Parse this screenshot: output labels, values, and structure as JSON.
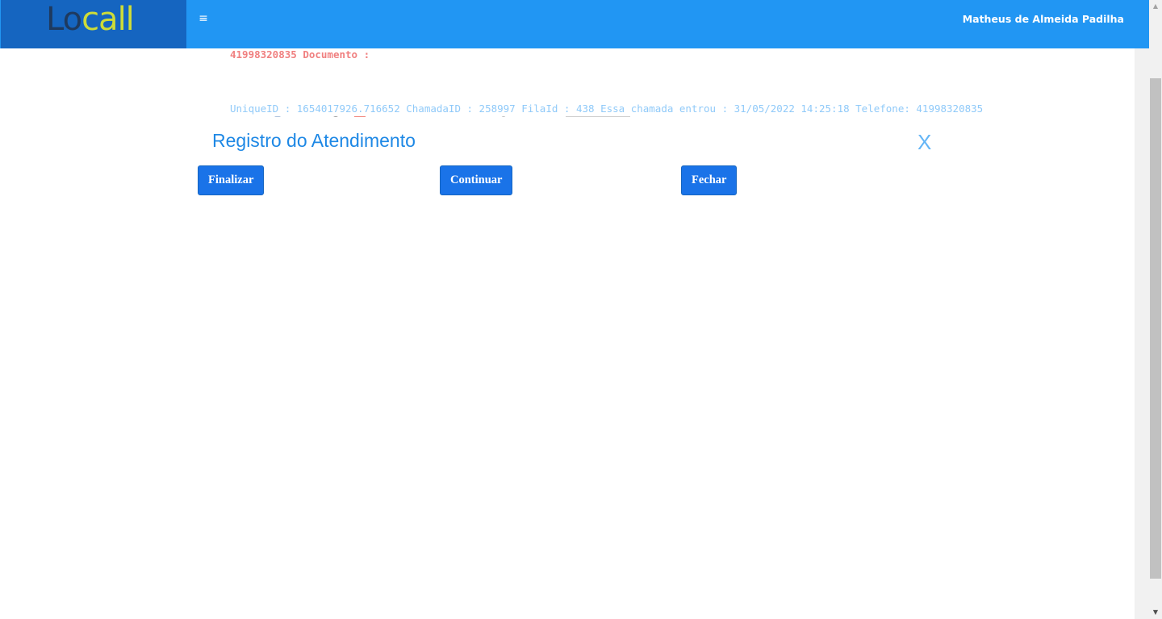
{
  "header": {
    "logo_text_lo": "Lo",
    "logo_text_call": "call",
    "user_name": "Matheus de Almeida Padilha",
    "menu_icon": "hamburger-icon"
  },
  "background": {
    "doc_number": "41998320835",
    "doc_label": "Documento :",
    "call_info": "UniqueID : 1654017926.716652 ChamadaID : 258997 FilaId : 438 Essa chamada entrou : 31/05/2022 14:25:18 Telefone: 41998320835"
  },
  "modal": {
    "title": "Registro do Atendimento",
    "close_label": "X",
    "buttons": {
      "finalizar": "Finalizar",
      "continuar": "Continuar",
      "fechar": "Fechar"
    }
  },
  "colors": {
    "topbar": "#2196f3",
    "logo_bg": "#1565c0",
    "button": "#1a73e8",
    "title": "#1e88e5"
  }
}
